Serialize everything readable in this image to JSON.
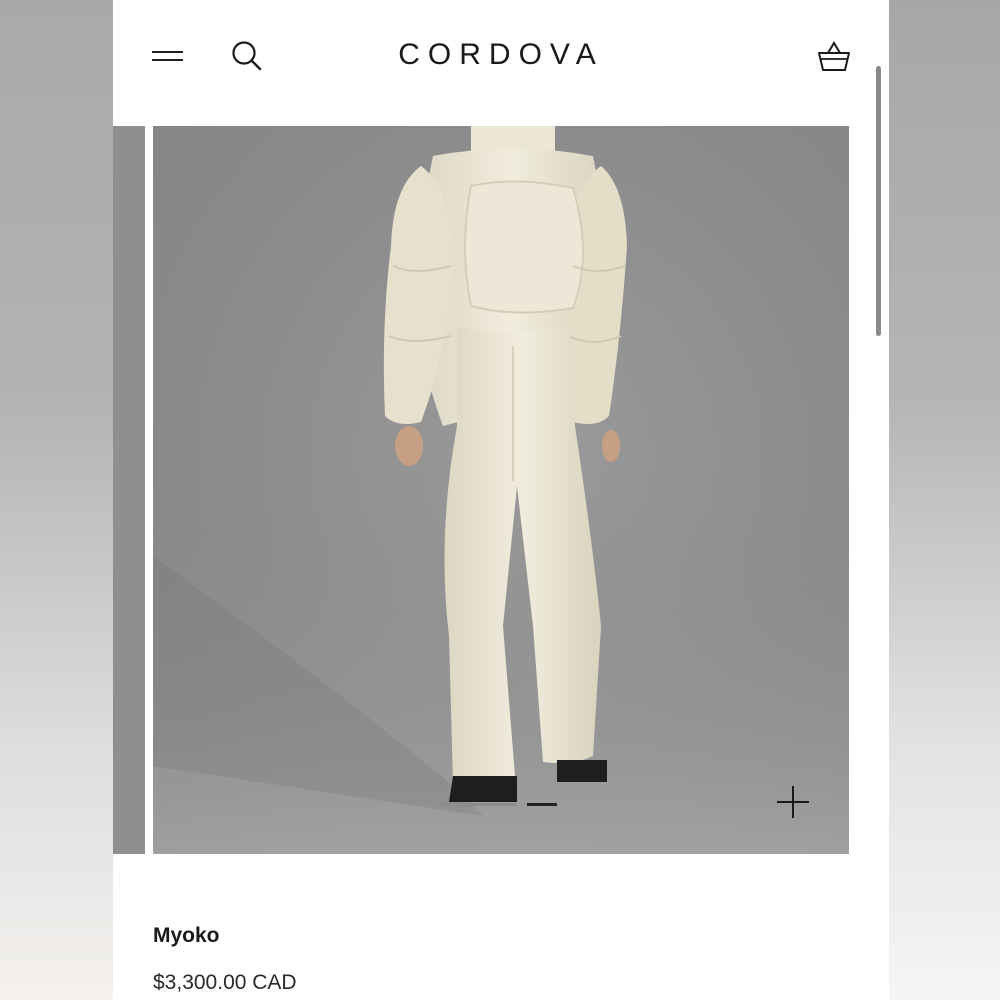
{
  "header": {
    "brand": "CORDOVA",
    "menu_icon": "hamburger-menu-icon",
    "search_icon": "search-icon",
    "cart_icon": "basket-icon"
  },
  "gallery": {
    "image_subject": "model-in-cream-puffer-jacket-and-flared-ski-pants",
    "slide_count": 2,
    "active_slide": 2,
    "zoom_icon": "plus-icon"
  },
  "product": {
    "name": "Myoko",
    "price": "$3,300.00 CAD"
  },
  "colors": {
    "text": "#1a1a1a",
    "background": "#ffffff",
    "photo_backdrop": "#8c8c8c",
    "garment": "#ede8d8"
  }
}
